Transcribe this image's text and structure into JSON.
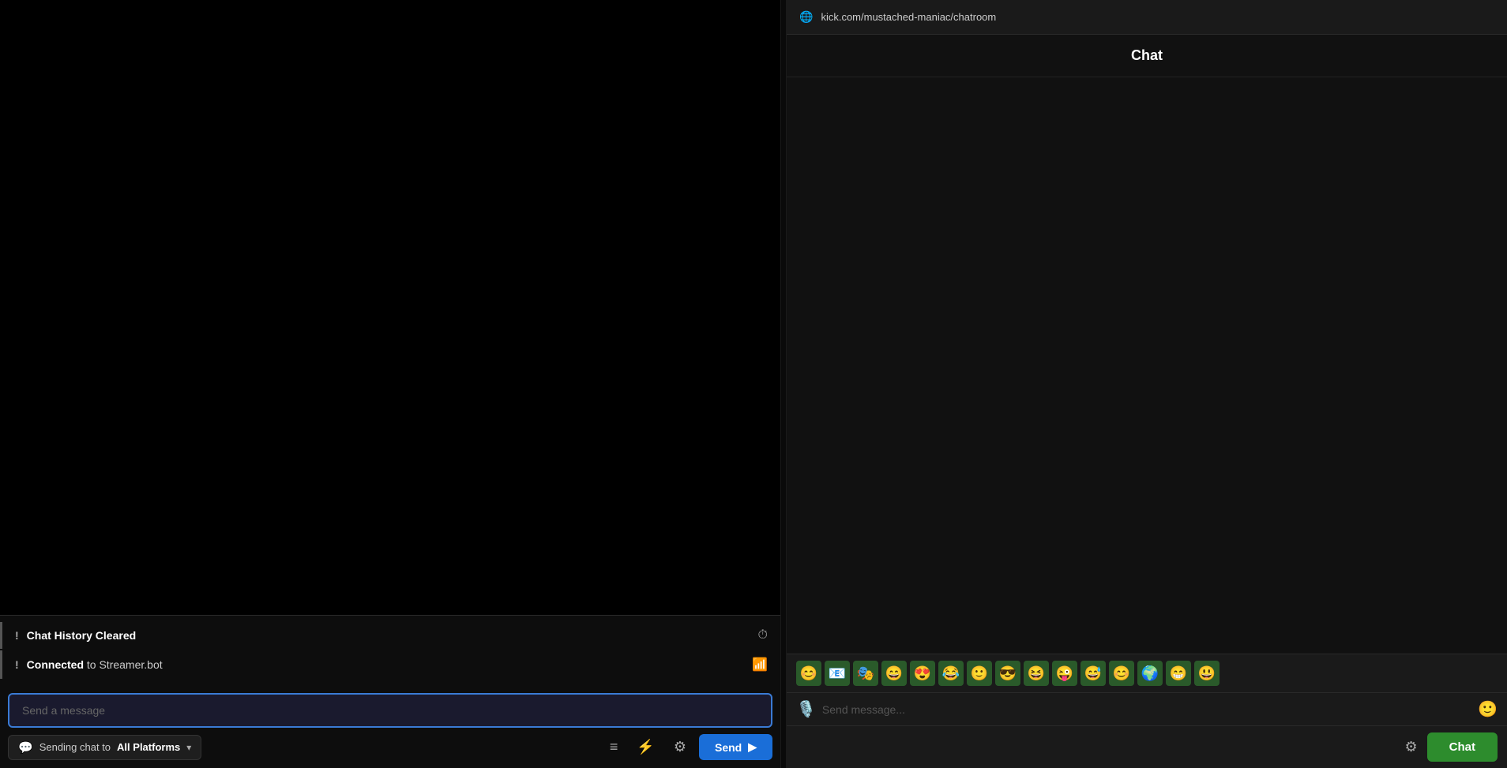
{
  "left": {
    "messages": [
      {
        "icon": "⏱",
        "exclamation": "!",
        "text_before_bold": "",
        "bold": "Chat History Cleared",
        "text_after": "",
        "icon_type": "history"
      },
      {
        "icon": "📶",
        "exclamation": "!",
        "text_before_bold": "",
        "bold": "Connected",
        "text_after": " to Streamer.bot",
        "icon_type": "wifi"
      }
    ],
    "input_placeholder": "Send a message",
    "platform_label_prefix": "Sending chat to ",
    "platform_label_bold": "All Platforms",
    "send_button_label": "Send",
    "toolbar": {
      "list_icon": "≡",
      "filter_icon": "⚡",
      "settings_icon": "⚙"
    }
  },
  "right": {
    "url": "kick.com/mustached-maniac/chatroom",
    "chat_title": "Chat",
    "input_placeholder": "Send message...",
    "emotes": [
      "😊",
      "📧",
      "🎭",
      "😄",
      "😍",
      "😂",
      "🙂",
      "😎",
      "😆",
      "😜",
      "😅",
      "😊",
      "🌍",
      "😁",
      "😃"
    ],
    "chat_button_label": "Chat",
    "settings_icon": "⚙"
  }
}
